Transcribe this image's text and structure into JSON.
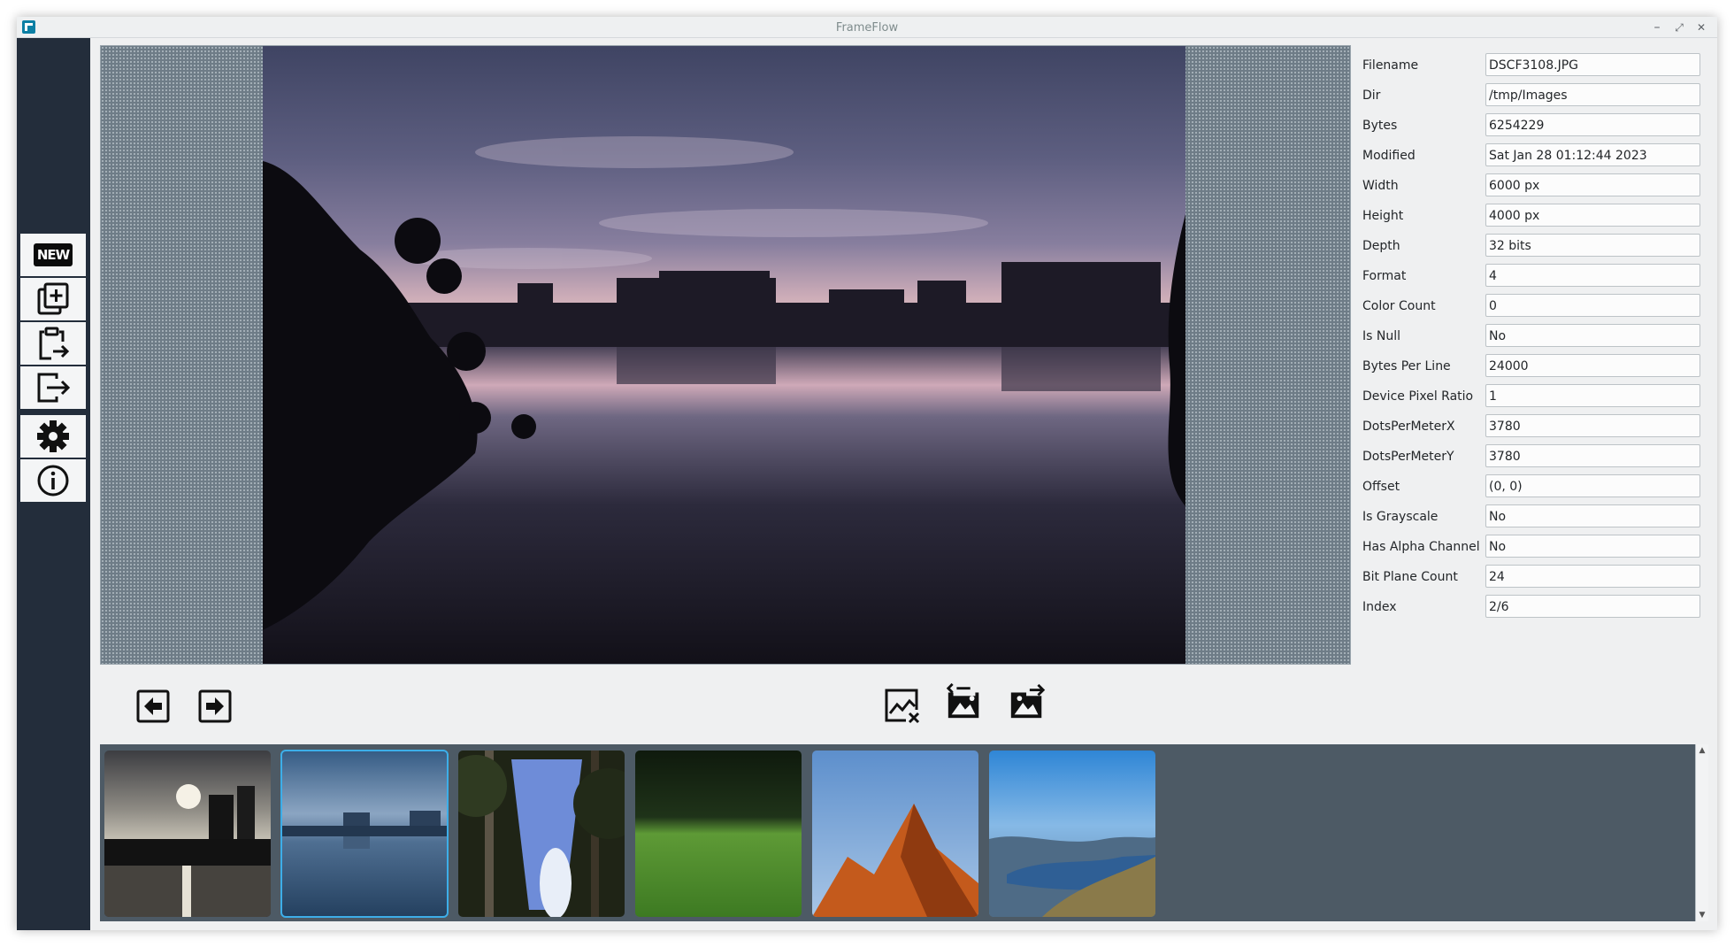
{
  "window": {
    "title": "FrameFlow",
    "minimize_label": "–",
    "maximize_label": "⤢",
    "close_label": "✕"
  },
  "sidebar": {
    "items": [
      {
        "name": "new-button",
        "icon": "new-icon",
        "badge": "NEW"
      },
      {
        "name": "add-images-button",
        "icon": "add-copy-icon"
      },
      {
        "name": "paste-button",
        "icon": "paste-icon"
      },
      {
        "name": "export-button",
        "icon": "export-icon"
      },
      {
        "name": "settings-button",
        "icon": "gear-icon"
      },
      {
        "name": "about-button",
        "icon": "info-icon"
      }
    ]
  },
  "properties": [
    {
      "label": "Filename",
      "value": "DSCF3108.JPG"
    },
    {
      "label": "Dir",
      "value": "/tmp/Images"
    },
    {
      "label": "Bytes",
      "value": "6254229"
    },
    {
      "label": "Modified",
      "value": "Sat Jan 28 01:12:44 2023"
    },
    {
      "label": "Width",
      "value": "6000 px"
    },
    {
      "label": "Height",
      "value": "4000 px"
    },
    {
      "label": "Depth",
      "value": "32 bits"
    },
    {
      "label": "Format",
      "value": "4"
    },
    {
      "label": "Color Count",
      "value": "0"
    },
    {
      "label": "Is Null",
      "value": "No"
    },
    {
      "label": "Bytes Per Line",
      "value": "24000"
    },
    {
      "label": "Device Pixel Ratio",
      "value": "1"
    },
    {
      "label": "DotsPerMeterX",
      "value": "3780"
    },
    {
      "label": "DotsPerMeterY",
      "value": "3780"
    },
    {
      "label": "Offset",
      "value": "(0, 0)"
    },
    {
      "label": "Is Grayscale",
      "value": "No"
    },
    {
      "label": "Has Alpha Channel",
      "value": "No"
    },
    {
      "label": "Bit Plane Count",
      "value": "24"
    },
    {
      "label": "Index",
      "value": "2/6"
    }
  ],
  "controls": {
    "previous_icon": "arrow-left-box-icon",
    "next_icon": "arrow-right-box-icon",
    "remove_icon": "image-remove-icon",
    "import_icon": "image-import-icon",
    "export_icon": "image-export-icon"
  },
  "thumbnails": [
    {
      "subject": "sunset-lake-towers",
      "selected": false
    },
    {
      "subject": "lake-reflection-dusk",
      "selected": true
    },
    {
      "subject": "forest-canopy-sky",
      "selected": false
    },
    {
      "subject": "green-field",
      "selected": false
    },
    {
      "subject": "orange-rock-peak",
      "selected": false
    },
    {
      "subject": "mountain-reservoir",
      "selected": false
    }
  ],
  "colors": {
    "sidebar_bg": "#232d3b",
    "strip_bg": "#4d5a65",
    "selection": "#3daee9"
  }
}
